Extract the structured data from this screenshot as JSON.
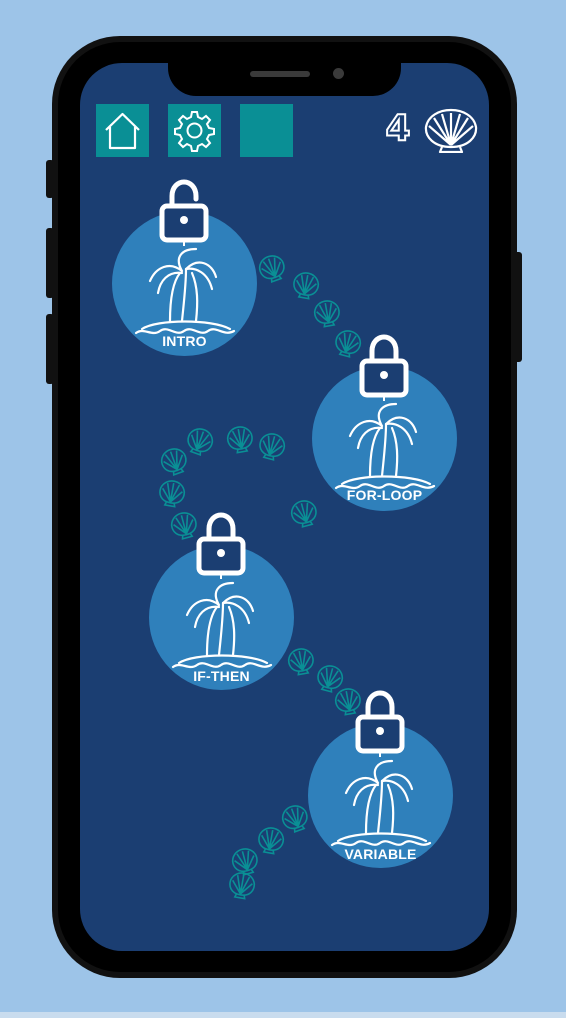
{
  "toolbar": {
    "home_icon": "home-icon",
    "settings_icon": "gear-icon",
    "blank_button": "blank-square",
    "shell_count": "4",
    "shell_icon": "scallop-shell-icon"
  },
  "levels": [
    {
      "label": "INTRO",
      "locked": true
    },
    {
      "label": "FOR-LOOP",
      "locked": true
    },
    {
      "label": "IF-THEN",
      "locked": true
    },
    {
      "label": "VARIABLE",
      "locked": true
    }
  ],
  "colors": {
    "background": "#9dc4e8",
    "screen": "#1b3e72",
    "island": "#2f80bb",
    "button": "#0a8f95",
    "path_shell": "#0a8f95"
  }
}
